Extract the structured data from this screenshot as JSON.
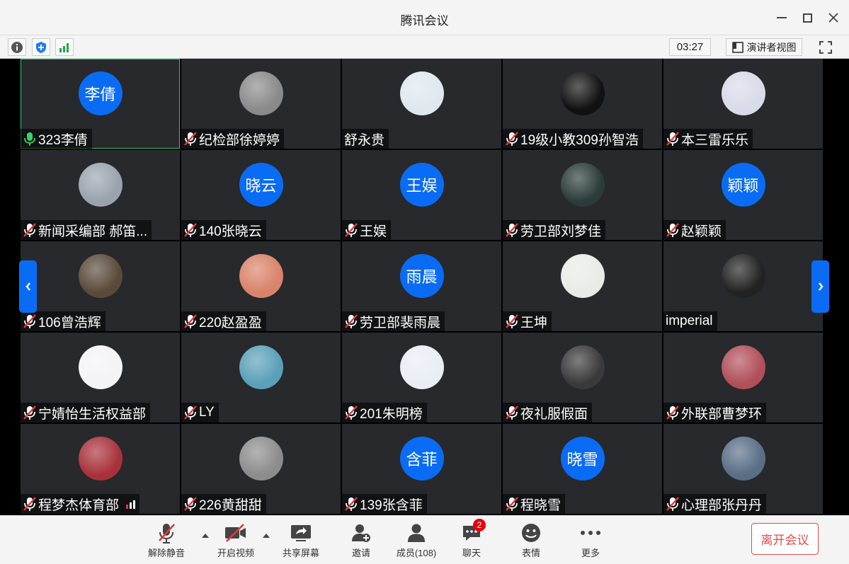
{
  "window": {
    "title": "腾讯会议"
  },
  "infobar": {
    "timer": "03:27",
    "speaker_view": "演讲者视图"
  },
  "tiles": [
    {
      "name": "323李倩",
      "avatar_text": "李倩",
      "mic": "on",
      "active": true
    },
    {
      "name": "纪检部徐婷婷",
      "avatar_color": "#8a8a8a",
      "mic": "muted"
    },
    {
      "name": "舒永贵",
      "avatar_color": "#dfe8ef",
      "mic": "none"
    },
    {
      "name": "19级小教309孙智浩",
      "avatar_color": "#111111",
      "mic": "muted"
    },
    {
      "name": "本三雷乐乐",
      "avatar_color": "#d8dbe8",
      "mic": "muted"
    },
    {
      "name": "新闻采编部 郝笛...",
      "avatar_color": "#9aa3ad",
      "mic": "muted"
    },
    {
      "name": "140张晓云",
      "avatar_text": "晓云",
      "mic": "muted"
    },
    {
      "name": "王娱",
      "avatar_text": "王娱",
      "mic": "muted"
    },
    {
      "name": "劳卫部刘梦佳",
      "avatar_color": "#2c3c3c",
      "mic": "muted"
    },
    {
      "name": "赵颖颖",
      "avatar_text": "颖颖",
      "mic": "muted"
    },
    {
      "name": "106曾浩辉",
      "avatar_color": "#5a4a3a",
      "mic": "muted"
    },
    {
      "name": "220赵盈盈",
      "avatar_color": "#d9836a",
      "mic": "muted"
    },
    {
      "name": "劳卫部裴雨晨",
      "avatar_text": "雨晨",
      "mic": "muted"
    },
    {
      "name": "王坤",
      "avatar_color": "#e8ece6",
      "mic": "muted"
    },
    {
      "name": "imperial",
      "avatar_color": "#222222",
      "mic": "none"
    },
    {
      "name": "宁婧怡生活权益部",
      "avatar_color": "#f4f4f6",
      "mic": "muted"
    },
    {
      "name": "LY",
      "avatar_color": "#5aa0b8",
      "mic": "muted"
    },
    {
      "name": "201朱明榜",
      "avatar_color": "#e9eef5",
      "mic": "muted"
    },
    {
      "name": "夜礼服假面",
      "avatar_color": "#3a3a3a",
      "mic": "muted"
    },
    {
      "name": "外联部曹梦环",
      "avatar_color": "#b0505a",
      "mic": "muted"
    },
    {
      "name": "程梦杰体育部",
      "avatar_color": "#a8323c",
      "mic": "muted",
      "signal": true
    },
    {
      "name": "226黄甜甜",
      "avatar_color": "#8c8c8c",
      "mic": "muted"
    },
    {
      "name": "139张含菲",
      "avatar_text": "含菲",
      "mic": "muted"
    },
    {
      "name": "程晓雪",
      "avatar_text": "晓雪",
      "mic": "muted"
    },
    {
      "name": "心理部张丹丹",
      "avatar_color": "#5a6e86",
      "mic": "muted"
    }
  ],
  "toolbar": {
    "unmute": "解除静音",
    "start_video": "开启视频",
    "share_screen": "共享屏幕",
    "invite": "邀请",
    "members": "成员(108)",
    "chat": "聊天",
    "chat_badge": "2",
    "reactions": "表情",
    "more": "更多",
    "leave": "离开会议"
  },
  "colors": {
    "accent": "#0a6cf5",
    "leave_red": "#e24b4b",
    "tile_bg": "#27292c"
  }
}
